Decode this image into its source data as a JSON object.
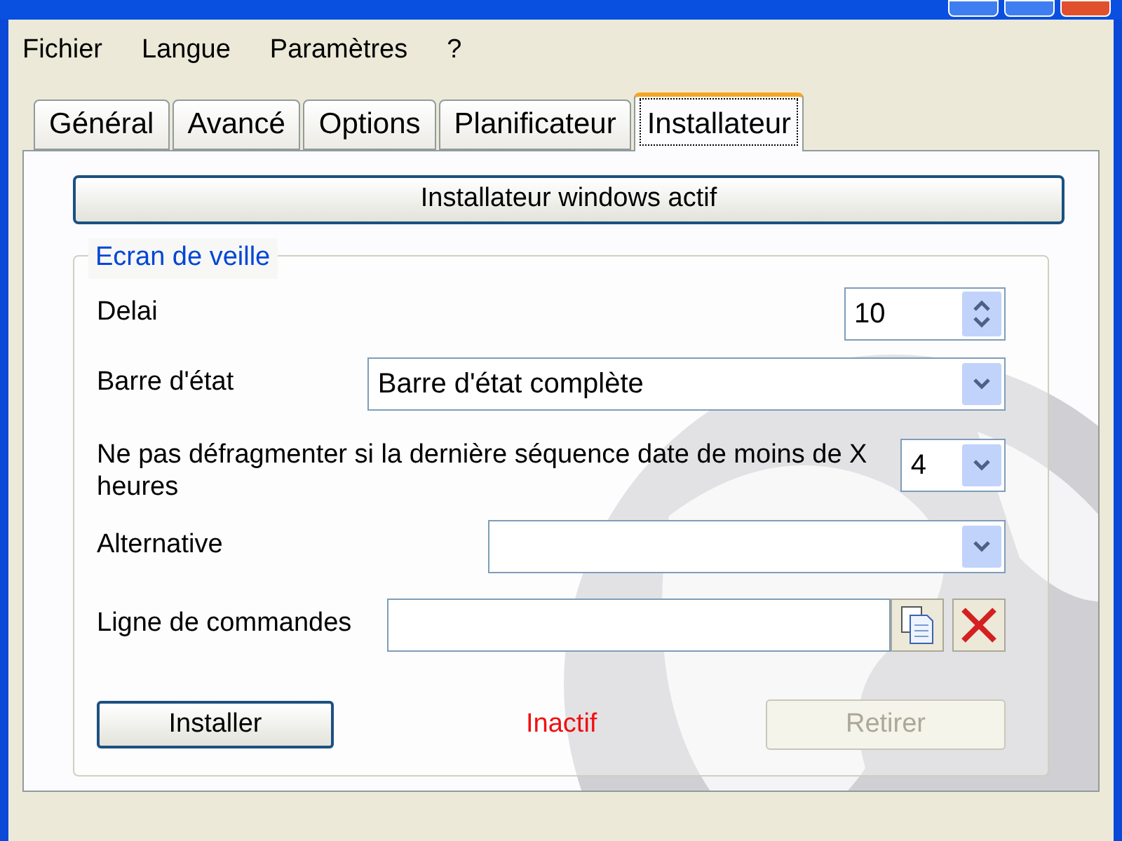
{
  "menu": [
    "Fichier",
    "Langue",
    "Paramètres",
    "?"
  ],
  "tabs": [
    {
      "label": "Général",
      "selected": false
    },
    {
      "label": "Avancé",
      "selected": false
    },
    {
      "label": "Options",
      "selected": false
    },
    {
      "label": "Planificateur",
      "selected": false
    },
    {
      "label": "Installateur",
      "selected": true
    }
  ],
  "toggle_button": {
    "label": "Installateur windows actif"
  },
  "group": {
    "title": "Ecran de veille",
    "rows": [
      {
        "kind": "spinner",
        "label": "Delai",
        "value": "10"
      },
      {
        "kind": "dropdown",
        "label": "Barre d'état",
        "value": "Barre d'état complète"
      },
      {
        "kind": "small-dropdown",
        "label": "Ne pas défragmenter si la dernière séquence date de moins de X heures",
        "value": "4"
      },
      {
        "kind": "dropdown",
        "label": "Alternative"
      },
      {
        "kind": "text",
        "label": "Ligne de commandes"
      }
    ],
    "actions": [
      {
        "label": "Installer",
        "disabled": false
      },
      {
        "label": "Retirer",
        "disabled": true
      }
    ],
    "status": "Inactif"
  }
}
